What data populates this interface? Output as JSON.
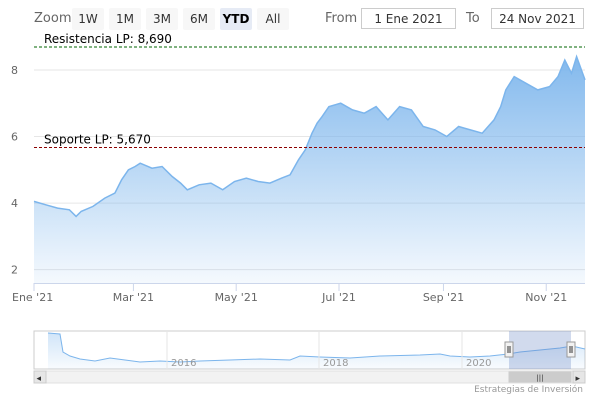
{
  "range_selector": {
    "zoom_label": "Zoom",
    "buttons": [
      "1W",
      "1M",
      "3M",
      "6M",
      "YTD",
      "All"
    ],
    "active": "YTD",
    "from_label": "From",
    "to_label": "To",
    "from_value": "1 Ene 2021",
    "to_value": "24 Nov 2021"
  },
  "credit": "Estrategias de Inversión",
  "colors": {
    "area_top": "#7cb5ec",
    "line": "#7cb5ec",
    "resistance_line": "#006400",
    "support_line": "#8b0000"
  },
  "chart_data": {
    "type": "area",
    "x_axis": {
      "min": "2021-01-01",
      "max": "2021-11-24",
      "tick_labels": [
        "Ene '21",
        "Mar '21",
        "May '21",
        "Jul '21",
        "Sep '21",
        "Nov '21"
      ],
      "tick_dates": [
        "2021-01-01",
        "2021-03-01",
        "2021-05-01",
        "2021-07-01",
        "2021-09-01",
        "2021-11-01"
      ]
    },
    "y_axis": {
      "min": 1.6,
      "max": 8.9,
      "ticks": [
        2,
        4,
        6,
        8
      ],
      "grid": true
    },
    "plot_lines": [
      {
        "label": "Resistencia LP: 8,690",
        "value": 8.69,
        "style": "dashed",
        "color": "#006400"
      },
      {
        "label": "Soporte LP: 5,670",
        "value": 5.67,
        "style": "dashed",
        "color": "#8b0000"
      }
    ],
    "series": [
      {
        "x": [
          "2021-01-01",
          "2021-01-08",
          "2021-01-15",
          "2021-01-22",
          "2021-01-26",
          "2021-01-29",
          "2021-02-05",
          "2021-02-12",
          "2021-02-18",
          "2021-02-22",
          "2021-02-26",
          "2021-03-02",
          "2021-03-05",
          "2021-03-12",
          "2021-03-18",
          "2021-03-24",
          "2021-03-29",
          "2021-04-02",
          "2021-04-09",
          "2021-04-16",
          "2021-04-23",
          "2021-04-30",
          "2021-05-07",
          "2021-05-14",
          "2021-05-21",
          "2021-05-28",
          "2021-06-02",
          "2021-06-07",
          "2021-06-11",
          "2021-06-15",
          "2021-06-18",
          "2021-06-21",
          "2021-06-25",
          "2021-07-02",
          "2021-07-09",
          "2021-07-16",
          "2021-07-23",
          "2021-07-30",
          "2021-08-06",
          "2021-08-13",
          "2021-08-20",
          "2021-08-27",
          "2021-09-03",
          "2021-09-10",
          "2021-09-17",
          "2021-09-24",
          "2021-10-01",
          "2021-10-05",
          "2021-10-08",
          "2021-10-13",
          "2021-10-20",
          "2021-10-27",
          "2021-11-03",
          "2021-11-08",
          "2021-11-12",
          "2021-11-16",
          "2021-11-19",
          "2021-11-24"
        ],
        "values": [
          4.05,
          3.95,
          3.85,
          3.8,
          3.6,
          3.75,
          3.9,
          4.15,
          4.3,
          4.7,
          5.0,
          5.1,
          5.2,
          5.05,
          5.1,
          4.8,
          4.6,
          4.4,
          4.55,
          4.6,
          4.4,
          4.65,
          4.75,
          4.65,
          4.6,
          4.75,
          4.85,
          5.3,
          5.6,
          6.1,
          6.4,
          6.6,
          6.9,
          7.0,
          6.8,
          6.7,
          6.9,
          6.5,
          6.9,
          6.8,
          6.3,
          6.2,
          6.0,
          6.3,
          6.2,
          6.1,
          6.5,
          6.9,
          7.4,
          7.8,
          7.6,
          7.4,
          7.5,
          7.8,
          8.3,
          7.9,
          8.4,
          7.7
        ]
      }
    ]
  },
  "navigator": {
    "tick_labels": [
      "2016",
      "2018",
      "2020"
    ],
    "scroll_left": "◂",
    "scroll_right": "▸",
    "scroll_grip": "|||"
  }
}
